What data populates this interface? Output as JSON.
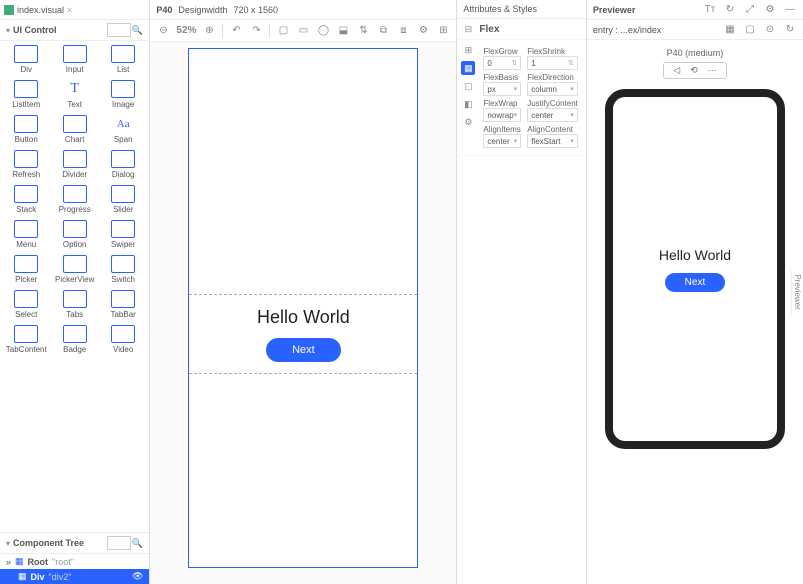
{
  "tab": {
    "name": "index.visual"
  },
  "uiControl": {
    "title": "UI Control",
    "items": [
      [
        {
          "l": "Div"
        },
        {
          "l": "Input"
        },
        {
          "l": "List"
        }
      ],
      [
        {
          "l": "ListItem"
        },
        {
          "l": "Text"
        },
        {
          "l": "Image"
        }
      ],
      [
        {
          "l": "Button"
        },
        {
          "l": "Chart"
        },
        {
          "l": "Span"
        }
      ],
      [
        {
          "l": "Refresh"
        },
        {
          "l": "Divider"
        },
        {
          "l": "Dialog"
        }
      ],
      [
        {
          "l": "Stack"
        },
        {
          "l": "Progress"
        },
        {
          "l": "Slider"
        }
      ],
      [
        {
          "l": "Menu"
        },
        {
          "l": "Option"
        },
        {
          "l": "Swiper"
        }
      ],
      [
        {
          "l": "Picker"
        },
        {
          "l": "PickerView"
        },
        {
          "l": "Switch"
        }
      ],
      [
        {
          "l": "Select"
        },
        {
          "l": "Tabs"
        },
        {
          "l": "TabBar"
        }
      ],
      [
        {
          "l": "TabContent"
        },
        {
          "l": "Badge"
        },
        {
          "l": "Video"
        }
      ]
    ]
  },
  "componentTree": {
    "title": "Component Tree",
    "root": {
      "name": "Root",
      "id": "\"root\""
    },
    "child": {
      "name": "Div",
      "id": "\"div2\""
    },
    "expand_icon": "»"
  },
  "canvasInfo": {
    "device": "P40",
    "label": "Designwidth",
    "size": "720 x 1560"
  },
  "zoom": {
    "value": "52%"
  },
  "toolbar_icons": [
    "⚙",
    "↺",
    "↻",
    "⎌",
    "⧉",
    "◯",
    "⧈",
    "⊕",
    "⊖",
    "⧉",
    "⧈",
    "⚙"
  ],
  "attrs": {
    "title": "Attributes & Styles",
    "component": "Flex",
    "fields": [
      {
        "k": "FlexGrow",
        "v": "0",
        "s": true
      },
      {
        "k": "FlexShrink",
        "v": "1",
        "s": true
      },
      {
        "k": "FlexBasis",
        "v": "px",
        "d": true
      },
      {
        "k": "FlexDirection",
        "v": "column",
        "d": true
      },
      {
        "k": "FlexWrap",
        "v": "nowrap",
        "d": true
      },
      {
        "k": "JustifyContent",
        "v": "center",
        "d": true
      },
      {
        "k": "AlignItems",
        "v": "center",
        "d": true
      },
      {
        "k": "AlignContent",
        "v": "flexStart",
        "d": true
      }
    ]
  },
  "preview": {
    "title": "Previewer",
    "entry": "entry : ...ex/index",
    "device": "P40 (medium)"
  },
  "content": {
    "hello": "Hello World",
    "next": "Next"
  }
}
